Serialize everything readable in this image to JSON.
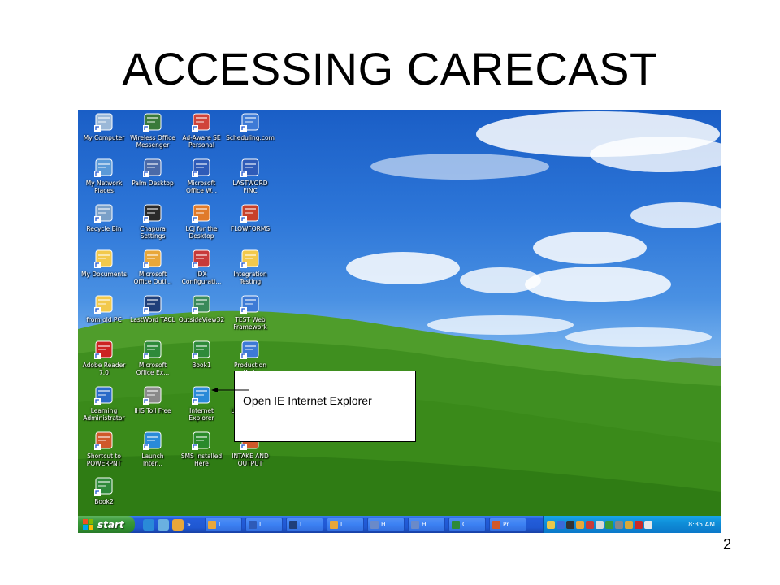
{
  "slide": {
    "title": "ACCESSING CARECAST",
    "page_number": "2"
  },
  "annotation": {
    "text": "Open IE Internet Explorer"
  },
  "desktop_icons": [
    {
      "label": "My Computer",
      "icon": "computer-icon",
      "color": "#9bb8d8"
    },
    {
      "label": "Wireless Office\nMessenger",
      "icon": "messenger-icon",
      "color": "#3a7a3a"
    },
    {
      "label": "Ad-Aware SE\nPersonal",
      "icon": "adaware-icon",
      "color": "#d0443a"
    },
    {
      "label": "Scheduling.com",
      "icon": "web-page-icon",
      "color": "#3d7ad6"
    },
    {
      "label": "My Network\nPlaces",
      "icon": "network-icon",
      "color": "#5a9ad8"
    },
    {
      "label": "Palm Desktop",
      "icon": "palm-icon",
      "color": "#4a6aa8"
    },
    {
      "label": "Microsoft\nOffice W...",
      "icon": "word-icon",
      "color": "#2e5bb8"
    },
    {
      "label": "LASTWORD\nFINC",
      "icon": "word-doc-icon",
      "color": "#2e5bb8"
    },
    {
      "label": "Recycle Bin",
      "icon": "recycle-bin-icon",
      "color": "#7aa0c8"
    },
    {
      "label": "Chapura\nSettings",
      "icon": "chapura-icon",
      "color": "#2a2a2a"
    },
    {
      "label": "LCJ for the\nDesktop",
      "icon": "lcj-icon",
      "color": "#e07a2a"
    },
    {
      "label": "FLOWFORMS",
      "icon": "flowforms-icon",
      "color": "#c8402a"
    },
    {
      "label": "My Documents",
      "icon": "folder-icon",
      "color": "#f2c94c"
    },
    {
      "label": "Microsoft\nOffice Outl...",
      "icon": "outlook-icon",
      "color": "#e8a73a"
    },
    {
      "label": "IDX\nConfigurati...",
      "icon": "idx-icon",
      "color": "#c83a3a"
    },
    {
      "label": "Integration\nTesting",
      "icon": "folder-icon",
      "color": "#f2c94c"
    },
    {
      "label": "from old PC",
      "icon": "folder-icon",
      "color": "#f2c94c"
    },
    {
      "label": "LastWord TACL",
      "icon": "lc-icon",
      "color": "#1f3f7a"
    },
    {
      "label": "OutsideView32",
      "icon": "outsideview-icon",
      "color": "#3a8a5a"
    },
    {
      "label": "TEST Web\nFramework",
      "icon": "web-page-icon",
      "color": "#3d7ad6"
    },
    {
      "label": "Adobe Reader\n7.0",
      "icon": "adobe-reader-icon",
      "color": "#cc2222"
    },
    {
      "label": "Microsoft\nOffice Ex...",
      "icon": "excel-icon",
      "color": "#2e8a3a"
    },
    {
      "label": "Book1",
      "icon": "excel-doc-icon",
      "color": "#2e8a3a"
    },
    {
      "label": "Production\nWeb",
      "icon": "web-page-icon",
      "color": "#3d7ad6"
    },
    {
      "label": "Learning\nAdministrator",
      "icon": "chart-icon",
      "color": "#2a6ac8"
    },
    {
      "label": "IHS Toll Free",
      "icon": "phone-icon",
      "color": "#8a8a8a"
    },
    {
      "label": "Internet\nExplorer",
      "icon": "internet-explorer-icon",
      "color": "#2a8ad8"
    },
    {
      "label": "LW TACL HNI",
      "icon": "lc-icon",
      "color": "#1f3f7a"
    },
    {
      "label": "Shortcut to\nPOWERPNT",
      "icon": "powerpoint-icon",
      "color": "#d0582a"
    },
    {
      "label": "Launch\nInter...",
      "icon": "internet-explorer-icon",
      "color": "#2a8ad8"
    },
    {
      "label": "SMS Installed\nHere",
      "icon": "sms-icon",
      "color": "#2a8a2a"
    },
    {
      "label": "INTAKE AND\nOUTPUT",
      "icon": "powerpoint-icon",
      "color": "#d0582a"
    },
    {
      "label": "Book2",
      "icon": "excel-doc-icon",
      "color": "#2e8a3a"
    }
  ],
  "taskbar": {
    "start_label": "start",
    "quick_launch": [
      {
        "icon": "ie-quicklaunch-icon",
        "color": "#2a8ad8"
      },
      {
        "icon": "settings-quicklaunch-icon",
        "color": "#6ab0e0"
      },
      {
        "icon": "outlook-quicklaunch-icon",
        "color": "#e8a73a"
      }
    ],
    "quick_launch_more": "»",
    "buttons": [
      {
        "label": "I...",
        "icon": "outlook-icon",
        "color": "#e8a73a"
      },
      {
        "label": "I...",
        "icon": "word-icon",
        "color": "#2e5bb8"
      },
      {
        "label": "L...",
        "icon": "lc-icon",
        "color": "#1f3f7a"
      },
      {
        "label": "I...",
        "icon": "outlook-icon",
        "color": "#e8a73a"
      },
      {
        "label": "H...",
        "icon": "window-icon",
        "color": "#6a8ac8"
      },
      {
        "label": "H...",
        "icon": "window-icon",
        "color": "#6a8ac8"
      },
      {
        "label": "C...",
        "icon": "excel-icon",
        "color": "#2e8a3a"
      },
      {
        "label": "Pr...",
        "icon": "powerpoint-icon",
        "color": "#d0582a"
      }
    ],
    "tray_icons": [
      {
        "icon": "mail-tray-icon",
        "color": "#e8c84a"
      },
      {
        "icon": "network-tray-icon",
        "color": "#3a6ad8"
      },
      {
        "icon": "phone-tray-icon",
        "color": "#333333"
      },
      {
        "icon": "outlook-tray-icon",
        "color": "#e8a73a"
      },
      {
        "icon": "security-tray-icon",
        "color": "#c83a3a"
      },
      {
        "icon": "antivirus-tray-icon",
        "color": "#d8d8d8"
      },
      {
        "icon": "sync-tray-icon",
        "color": "#3a9a3a"
      },
      {
        "icon": "tool-tray-icon",
        "color": "#888888"
      },
      {
        "icon": "pen-tray-icon",
        "color": "#d8a83a"
      },
      {
        "icon": "norton-tray-icon",
        "color": "#c82a2a"
      },
      {
        "icon": "volume-tray-icon",
        "color": "#e8e8e8"
      }
    ],
    "clock": "8:35 AM"
  }
}
